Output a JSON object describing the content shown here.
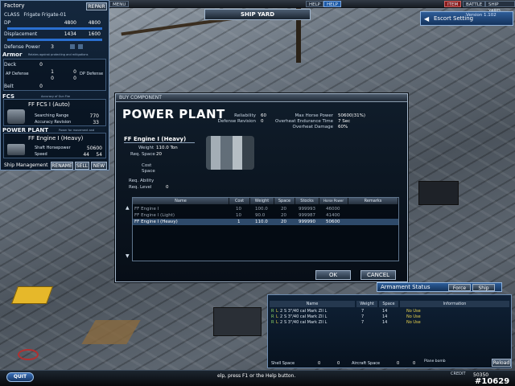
{
  "topbar": {
    "items": [
      "MENU",
      "HELP",
      "HELP",
      "ITEM",
      "BATTLE",
      "SHIP YARD"
    ]
  },
  "shipyard_title": "SHIP YARD",
  "escort": {
    "label": "Escort Setting",
    "version": "Version 1.102"
  },
  "factory": {
    "title": "Factory",
    "repair_label": "REPAIR",
    "class_label": "CLASS",
    "class_value": "Frigate Frigate-01",
    "dp_label": "DP",
    "dp_values": [
      "4800",
      "4800"
    ],
    "displacement_label": "Displacement",
    "displacement_values": [
      "1434",
      "1600"
    ],
    "defense_power_label": "Defense Power",
    "defense_power_value": "3",
    "armor_label": "Armor",
    "armor_sub": "Relates against protecting and mitigations",
    "deck_label": "Deck",
    "deck_value": "0",
    "ap_defense_label": "AP Defense",
    "ap_values": [
      "1",
      "0"
    ],
    "dp_defense_label": "DP Defense",
    "dp_def_values": [
      "0",
      "0"
    ],
    "belt_label": "Belt",
    "belt_value": "0",
    "fcs_label": "FCS",
    "fcs_sub": "Accuracy of Gun Fire",
    "fcs_name": "FF FCS I (Auto)",
    "searching_label": "Searching Range",
    "searching_value": "770",
    "accuracy_label": "Accuracy Revision",
    "accuracy_value": "33",
    "power_label": "POWER PLANT",
    "power_sub": "Power for movement and",
    "power_name": "FF Engine I (Heavy)",
    "shaft_label": "Shaft Horsepower",
    "shaft_value": "50600",
    "speed_label": "Speed",
    "speed_values": [
      "44",
      "54"
    ],
    "ship_mgmt": "Ship Management",
    "rename": "RENAME",
    "sell": "SELL",
    "new": "NEW"
  },
  "buy": {
    "header": "BUY COMPONENT",
    "title": "POWER PLANT",
    "reliability_label": "Reliability",
    "reliability_value": "60",
    "defense_rev_label": "Defense Revision",
    "defense_rev_value": "0",
    "max_hp_label": "Max Horse Power",
    "max_hp_value": "50600(31%)",
    "overheat_label": "Overheat Endurance Time",
    "overheat_value": "7 Sec",
    "overheat_dmg_label": "Overheat Damage",
    "overheat_dmg_value": "60%",
    "engine_name": "FF Engine I (Heavy)",
    "weight_label": "Weight",
    "weight_value": "110.0 Ton",
    "req_space_label": "Req. Space",
    "req_space_value": "20",
    "cost_label": "Cost",
    "space_label": "Space",
    "req_ability_label": "Req. Ability",
    "req_level_label": "Req. Level",
    "req_level_value": "0",
    "columns": [
      "Name",
      "Cost",
      "Weight",
      "Space",
      "Stocks",
      "Horse Power",
      "Remarks"
    ],
    "rows": [
      [
        "FF Engine I",
        "10",
        "100.0",
        "20",
        "999993",
        "46000",
        ""
      ],
      [
        "FF Engine I (Light)",
        "10",
        "90.0",
        "20",
        "999987",
        "41400",
        ""
      ],
      [
        "FF Engine I (Heavy)",
        "1",
        "110.0",
        "20",
        "999990",
        "50600",
        ""
      ]
    ],
    "ok": "OK",
    "cancel": "CANCEL"
  },
  "armament": {
    "title": "Armament Status",
    "force": "Force",
    "ship": "Ship",
    "columns": [
      "Name",
      "Weight",
      "Space",
      "Information"
    ],
    "rows": [
      [
        "R",
        "L",
        "2",
        "S 3\"/40 cal Mark ZII L",
        "7",
        "14",
        "No Use"
      ],
      [
        "R",
        "L",
        "2",
        "S 3\"/40 cal Mark ZII L",
        "7",
        "14",
        "No Use"
      ],
      [
        "R",
        "L",
        "2",
        "S 3\"/40 cal Mark ZII L",
        "7",
        "14",
        "No Use"
      ]
    ],
    "shell_space": "Shell Space",
    "shell_values": [
      "0",
      "0"
    ],
    "aircraft_space": "Aircraft Space",
    "aircraft_values": [
      "0",
      "0"
    ],
    "plane_bomb": "Plane bomb",
    "reload": "Reload"
  },
  "bottom": {
    "quit": "QUIT",
    "hint": "elp, press F1 or the Help button.",
    "credit_label": "CREDIT",
    "credit_value": "50350",
    "watermark": "#10629"
  },
  "colors": {
    "panel": "#0b1828",
    "accent_blue": "#2d5e9a",
    "highlight": "#2e4a6a",
    "text_green": "#8fdc6a",
    "text_yellow": "#e8d24c"
  }
}
